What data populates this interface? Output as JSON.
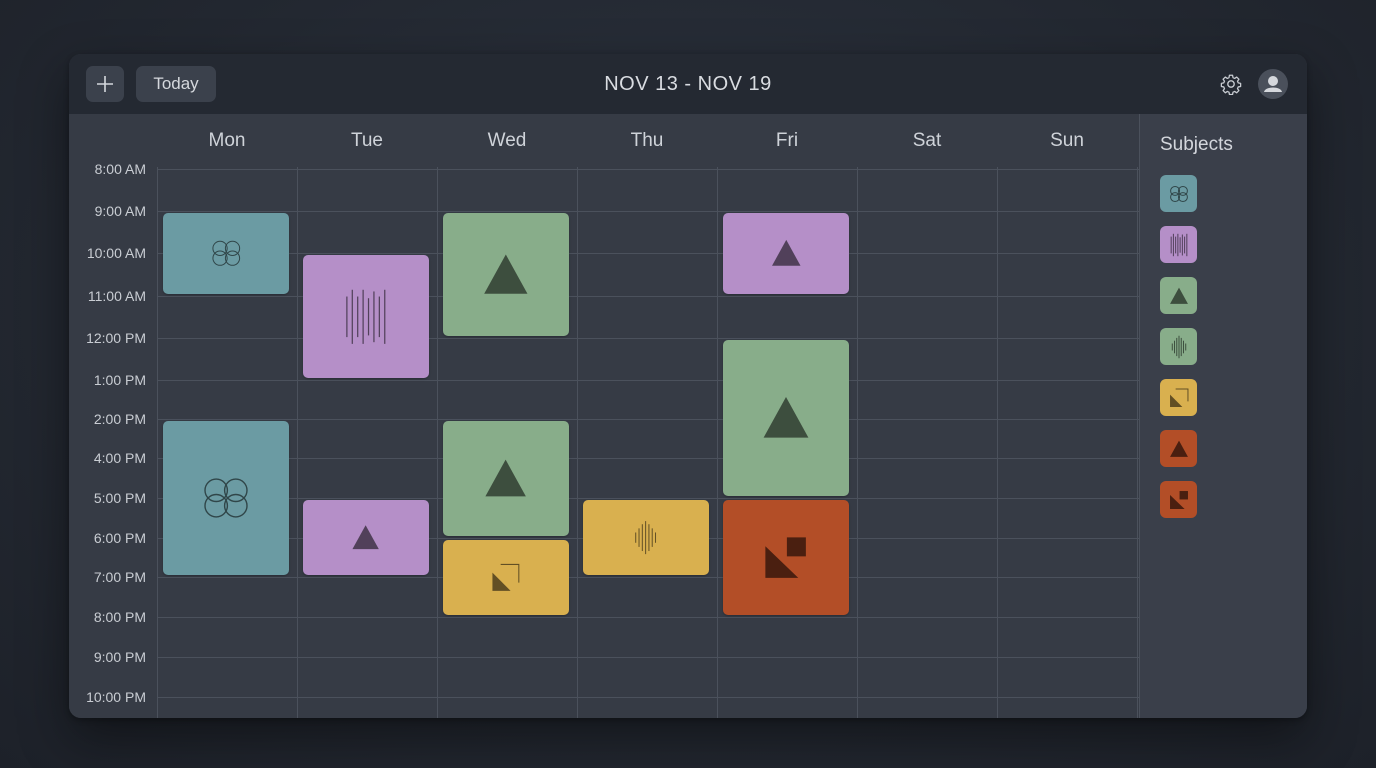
{
  "toolbar": {
    "add_icon": "plus-icon",
    "today_label": "Today",
    "date_range": "NOV 13 - NOV 19",
    "settings_icon": "gear-icon",
    "profile_icon": "user-avatar-icon"
  },
  "calendar": {
    "days": [
      "Mon",
      "Tue",
      "Wed",
      "Thu",
      "Fri",
      "Sat",
      "Sun"
    ],
    "times": [
      "8:00 AM",
      "9:00 AM",
      "10:00 AM",
      "11:00 AM",
      "12:00 PM",
      "1:00 PM",
      "2:00 PM",
      "4:00 PM",
      "5:00 PM",
      "6:00 PM",
      "7:00 PM",
      "8:00 PM",
      "9:00 PM",
      "10:00 PM"
    ],
    "events": [
      {
        "day": "Mon",
        "start": "9:00 AM",
        "end": "11:00 AM",
        "color": "#6b9ba3",
        "icon": "four-circles-icon"
      },
      {
        "day": "Mon",
        "start": "2:00 PM",
        "end": "7:00 PM",
        "color": "#6b9ba3",
        "icon": "four-circles-icon"
      },
      {
        "day": "Tue",
        "start": "10:00 AM",
        "end": "1:00 PM",
        "color": "#b58fc8",
        "icon": "vertical-lines-icon"
      },
      {
        "day": "Tue",
        "start": "5:00 PM",
        "end": "7:00 PM",
        "color": "#b58fc8",
        "icon": "triangle-icon"
      },
      {
        "day": "Wed",
        "start": "9:00 AM",
        "end": "12:00 PM",
        "color": "#88ad8a",
        "icon": "triangle-icon"
      },
      {
        "day": "Wed",
        "start": "2:00 PM",
        "end": "6:00 PM",
        "color": "#88ad8a",
        "icon": "triangle-icon"
      },
      {
        "day": "Wed",
        "start": "6:00 PM",
        "end": "8:00 PM",
        "color": "#d9b04f",
        "icon": "corner-triangle-icon"
      },
      {
        "day": "Thu",
        "start": "5:00 PM",
        "end": "7:00 PM",
        "color": "#d9b04f",
        "icon": "wave-lines-icon"
      },
      {
        "day": "Fri",
        "start": "9:00 AM",
        "end": "11:00 AM",
        "color": "#b58fc8",
        "icon": "triangle-icon"
      },
      {
        "day": "Fri",
        "start": "12:00 PM",
        "end": "5:00 PM",
        "color": "#88ad8a",
        "icon": "triangle-icon"
      },
      {
        "day": "Fri",
        "start": "5:00 PM",
        "end": "8:00 PM",
        "color": "#b34e27",
        "icon": "triangle-square-icon"
      }
    ]
  },
  "sidebar": {
    "title": "Subjects",
    "subjects": [
      {
        "color": "#6b9ba3",
        "icon": "four-circles-icon"
      },
      {
        "color": "#b58fc8",
        "icon": "vertical-lines-icon"
      },
      {
        "color": "#88ad8a",
        "icon": "triangle-icon"
      },
      {
        "color": "#88ad8a",
        "icon": "wave-lines-icon"
      },
      {
        "color": "#d9b04f",
        "icon": "corner-triangle-icon"
      },
      {
        "color": "#b34e27",
        "icon": "triangle-icon"
      },
      {
        "color": "#b34e27",
        "icon": "triangle-square-icon"
      }
    ]
  }
}
